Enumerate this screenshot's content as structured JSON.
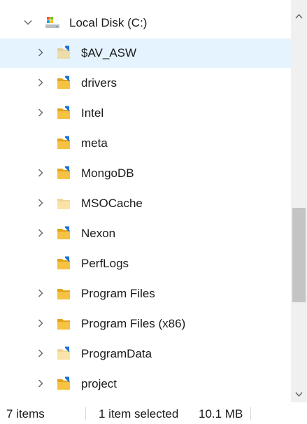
{
  "tree": {
    "root": {
      "label": "Local Disk (C:)",
      "icon": "local-disk-icon",
      "expanded": true
    },
    "items": [
      {
        "label": "$AV_ASW",
        "has_children": true,
        "selected": true,
        "icon": "folder-hidden-shared-icon",
        "style": "hidden-shared"
      },
      {
        "label": "drivers",
        "has_children": true,
        "selected": false,
        "icon": "folder-shared-icon",
        "style": "shared"
      },
      {
        "label": "Intel",
        "has_children": true,
        "selected": false,
        "icon": "folder-shared-icon",
        "style": "shared"
      },
      {
        "label": "meta",
        "has_children": false,
        "selected": false,
        "icon": "folder-shared-icon",
        "style": "shared"
      },
      {
        "label": "MongoDB",
        "has_children": true,
        "selected": false,
        "icon": "folder-shared-icon",
        "style": "shared"
      },
      {
        "label": "MSOCache",
        "has_children": true,
        "selected": false,
        "icon": "folder-hidden-icon",
        "style": "hidden"
      },
      {
        "label": "Nexon",
        "has_children": true,
        "selected": false,
        "icon": "folder-shared-icon",
        "style": "shared"
      },
      {
        "label": "PerfLogs",
        "has_children": false,
        "selected": false,
        "icon": "folder-shared-icon",
        "style": "shared"
      },
      {
        "label": "Program Files",
        "has_children": true,
        "selected": false,
        "icon": "folder-icon",
        "style": "plain"
      },
      {
        "label": "Program Files (x86)",
        "has_children": true,
        "selected": false,
        "icon": "folder-icon",
        "style": "plain"
      },
      {
        "label": "ProgramData",
        "has_children": true,
        "selected": false,
        "icon": "folder-hidden-shared-icon",
        "style": "hidden-shared"
      },
      {
        "label": "project",
        "has_children": true,
        "selected": false,
        "icon": "folder-shared-icon",
        "style": "shared"
      }
    ]
  },
  "status_bar": {
    "item_count": "7 items",
    "selection": "1 item selected",
    "size": "10.1 MB"
  },
  "colors": {
    "selected_row": "#e5f3ff",
    "folder": "#f5c243",
    "folder_back": "#e2a319",
    "share_blue": "#1f6fd1",
    "chevron": "#6d6d6d"
  }
}
